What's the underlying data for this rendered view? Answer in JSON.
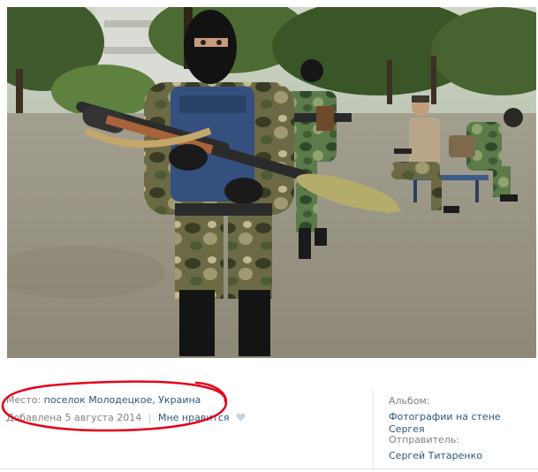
{
  "photo": {
    "alt": "photo"
  },
  "details": {
    "place_label": "Место:",
    "place_value": "поселок Молодецкое, Украина",
    "added_text": "Добавлена 5 августа 2014",
    "separator": "|",
    "like_label": "Мне нравится",
    "like_icon": "heart-icon"
  },
  "sidebar": {
    "album_label": "Альбом:",
    "album_value": "Фотографии на стене Сергея",
    "sender_label": "Отправитель:",
    "sender_value": "Сергей Титаренко"
  },
  "colors": {
    "link": "#2b587a",
    "muted": "#828282",
    "annotation": "#e3001b"
  }
}
